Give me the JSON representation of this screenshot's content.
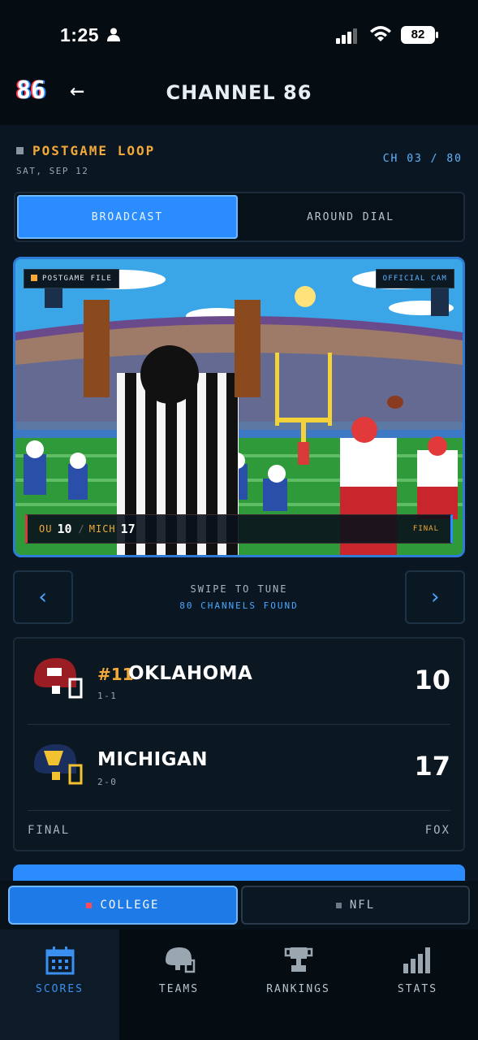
{
  "status_bar": {
    "time": "1:25",
    "battery": "82"
  },
  "header": {
    "logo": "86",
    "title": "CHANNEL 86"
  },
  "program": {
    "title": "POSTGAME LOOP",
    "date": "SAT, SEP 12",
    "channel": "CH 03 / 80"
  },
  "view_tabs": [
    {
      "label": "BROADCAST",
      "active": true
    },
    {
      "label": "AROUND DIAL",
      "active": false
    }
  ],
  "hero": {
    "tag_left": "POSTGAME FILE",
    "tag_right": "OFFICIAL CAM",
    "score": {
      "home_abbr": "OU",
      "home_score": "10",
      "away_abbr": "MICH",
      "away_score": "17",
      "status": "FINAL"
    }
  },
  "tuner": {
    "title": "SWIPE TO TUNE",
    "subtitle": "80 CHANNELS FOUND"
  },
  "scorecard": {
    "teams": [
      {
        "rank": "#11",
        "name": "OKLAHOMA",
        "record": "1-1",
        "score": "10",
        "helmet_color": "#9b1d24",
        "helmet_icon": "helmet-oklahoma-icon"
      },
      {
        "rank": "",
        "name": "MICHIGAN",
        "record": "2-0",
        "score": "17",
        "helmet_color": "#1b2f5e",
        "helmet_icon": "helmet-michigan-icon"
      }
    ],
    "status": "FINAL",
    "network": "FOX"
  },
  "leagues": [
    {
      "label": "COLLEGE",
      "active": true
    },
    {
      "label": "NFL",
      "active": false
    }
  ],
  "tabbar": [
    {
      "label": "SCORES",
      "icon": "calendar-icon",
      "active": true
    },
    {
      "label": "TEAMS",
      "icon": "helmet-icon",
      "active": false
    },
    {
      "label": "RANKINGS",
      "icon": "trophy-icon",
      "active": false
    },
    {
      "label": "STATS",
      "icon": "bar-chart-icon",
      "active": false
    }
  ],
  "colors": {
    "accent": "#2a8cff",
    "gold": "#f2a93a",
    "background": "#0a1722"
  }
}
